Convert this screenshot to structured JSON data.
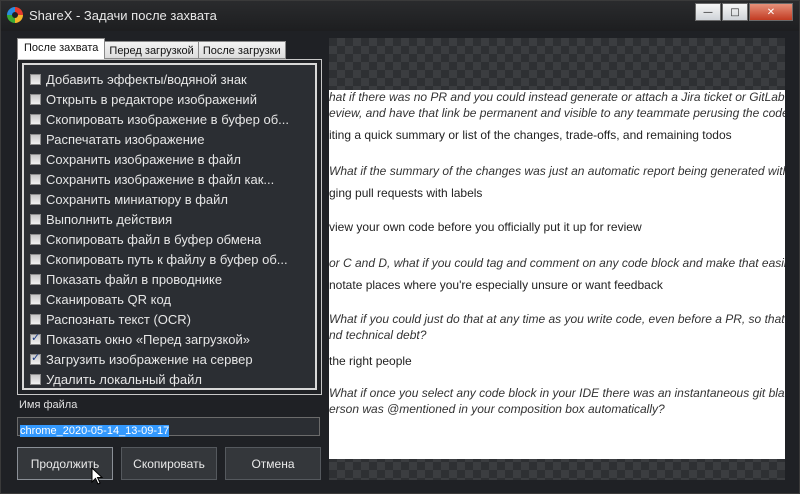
{
  "window": {
    "title": "ShareX - Задачи после захвата"
  },
  "tabs": [
    {
      "label": "После захвата",
      "active": true
    },
    {
      "label": "Перед загрузкой",
      "active": false
    },
    {
      "label": "После загрузки",
      "active": false
    }
  ],
  "tasks": [
    {
      "label": "Добавить эффекты/водяной знак",
      "checked": false
    },
    {
      "label": "Открыть в редакторе изображений",
      "checked": false
    },
    {
      "label": "Скопировать изображение в буфер об...",
      "checked": false
    },
    {
      "label": "Распечатать изображение",
      "checked": false
    },
    {
      "label": "Сохранить изображение в файл",
      "checked": false
    },
    {
      "label": "Сохранить изображение в файл как...",
      "checked": false
    },
    {
      "label": "Сохранить миниатюру в файл",
      "checked": false
    },
    {
      "label": "Выполнить действия",
      "checked": false
    },
    {
      "label": "Скопировать файл в буфер обмена",
      "checked": false
    },
    {
      "label": "Скопировать путь к файлу в буфер об...",
      "checked": false
    },
    {
      "label": "Показать файл в проводнике",
      "checked": false
    },
    {
      "label": "Сканировать QR код",
      "checked": false
    },
    {
      "label": "Распознать текст (OCR)",
      "checked": false
    },
    {
      "label": "Показать окно «Перед загрузкой»",
      "checked": true
    },
    {
      "label": "Загрузить изображение на сервер",
      "checked": true
    },
    {
      "label": "Удалить локальный файл",
      "checked": false
    }
  ],
  "filename": {
    "label": "Имя файла",
    "value": "chrome_2020-05-14_13-09-17"
  },
  "buttons": {
    "continue": "Продолжить",
    "copy": "Скопировать",
    "cancel": "Отмена"
  },
  "preview_lines": [
    {
      "text": "hat if there was no PR and you could instead generate or attach a Jira ticket or GitLab issue",
      "style": "i"
    },
    {
      "text": "eview, and have that link be permanent and visible to any teammate perusing the code?",
      "style": "i"
    },
    {
      "text": "iting a quick summary or list of the changes, trade-offs, and remaining todos",
      "style": "n"
    },
    {
      "text": "What if the summary of the changes was just an automatic report being generated within your",
      "style": "i"
    },
    {
      "text": "ging pull requests with labels",
      "style": "n"
    },
    {
      "text": "view your own code before you officially put it up for review",
      "style": "n"
    },
    {
      "text": "or C and D, what if you could tag and comment on any code block and make that easily accessible",
      "style": "i"
    },
    {
      "text": "notate places where you're especially unsure or want feedback",
      "style": "n"
    },
    {
      "text": "What if you could just do that at any time as you write code, even before a PR, so that the feedback",
      "style": "i"
    },
    {
      "text": "nd technical debt?",
      "style": "i"
    },
    {
      "text": "the right people",
      "style": "n"
    },
    {
      "text": "What if once you select any code block in your IDE there was an instantaneous git blame lookup",
      "style": "i"
    },
    {
      "text": "erson was @mentioned in your composition box automatically?",
      "style": "i"
    }
  ],
  "caption_buttons": {
    "minimize": "—",
    "maximize": "□",
    "close": "✕"
  }
}
